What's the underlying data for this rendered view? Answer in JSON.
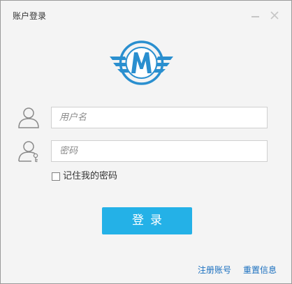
{
  "window": {
    "title": "账户登录"
  },
  "titlebar": {
    "minimize_icon": "minimize-icon",
    "close_icon": "close-icon"
  },
  "logo": {
    "letter": "M",
    "icon": "winged-m-logo",
    "color": "#2a8fcf"
  },
  "form": {
    "username": {
      "placeholder": "用户名",
      "value": "",
      "icon": "user-icon"
    },
    "password": {
      "placeholder": "密码",
      "value": "",
      "icon": "user-key-icon"
    },
    "remember": {
      "label": "记住我的密码",
      "checked": false
    },
    "login_button": {
      "label": "登录",
      "color": "#24b1e7"
    }
  },
  "footer": {
    "register_link": "注册账号",
    "reset_link": "重置信息",
    "link_color": "#1a6fbf"
  }
}
